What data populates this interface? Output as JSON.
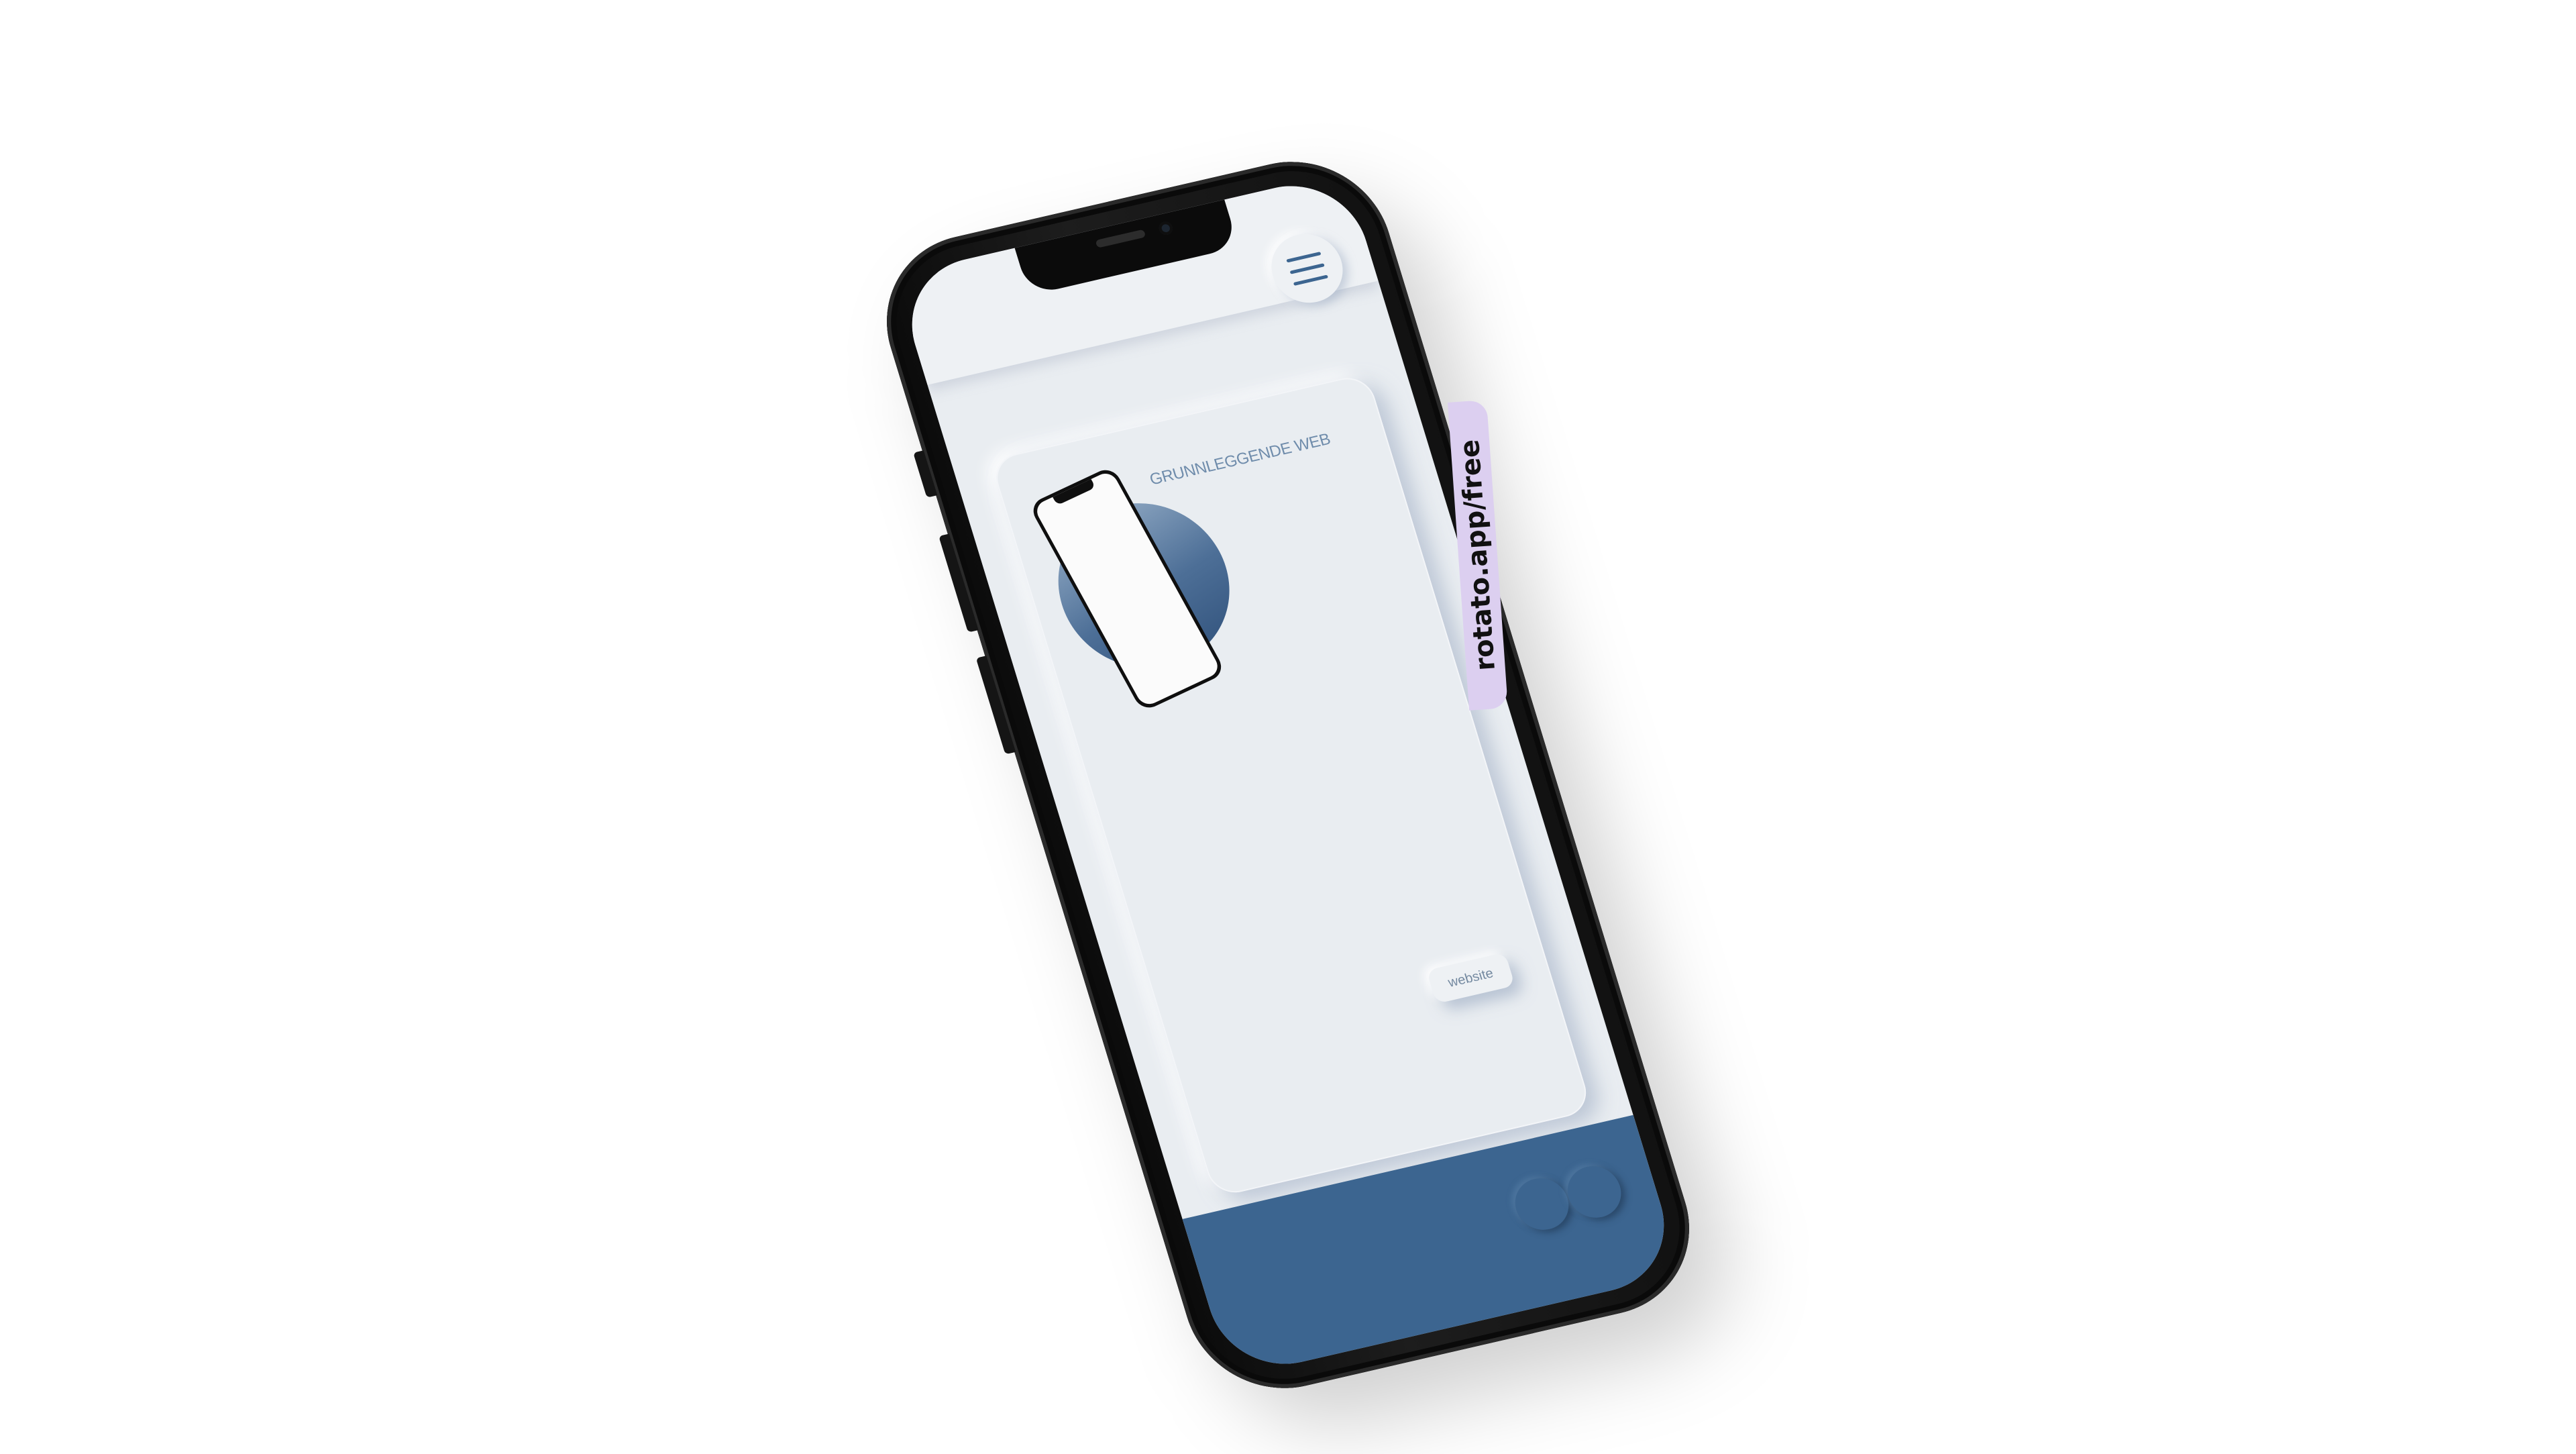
{
  "screen_header": {
    "menu_icon": "hamburger-menu-icon"
  },
  "card": {
    "title": "GRUNNLEGGENDE WEB",
    "button_label": "website"
  },
  "footer": {
    "icons": [
      "circle-button-icon",
      "circle-button-icon"
    ]
  },
  "watermark": {
    "text": "rotato.app/free"
  },
  "colors": {
    "accent_blue": "#3c6590",
    "screen_background": "#e9edf1",
    "device_frame": "#111111",
    "watermark_tab": "#dccff0"
  }
}
